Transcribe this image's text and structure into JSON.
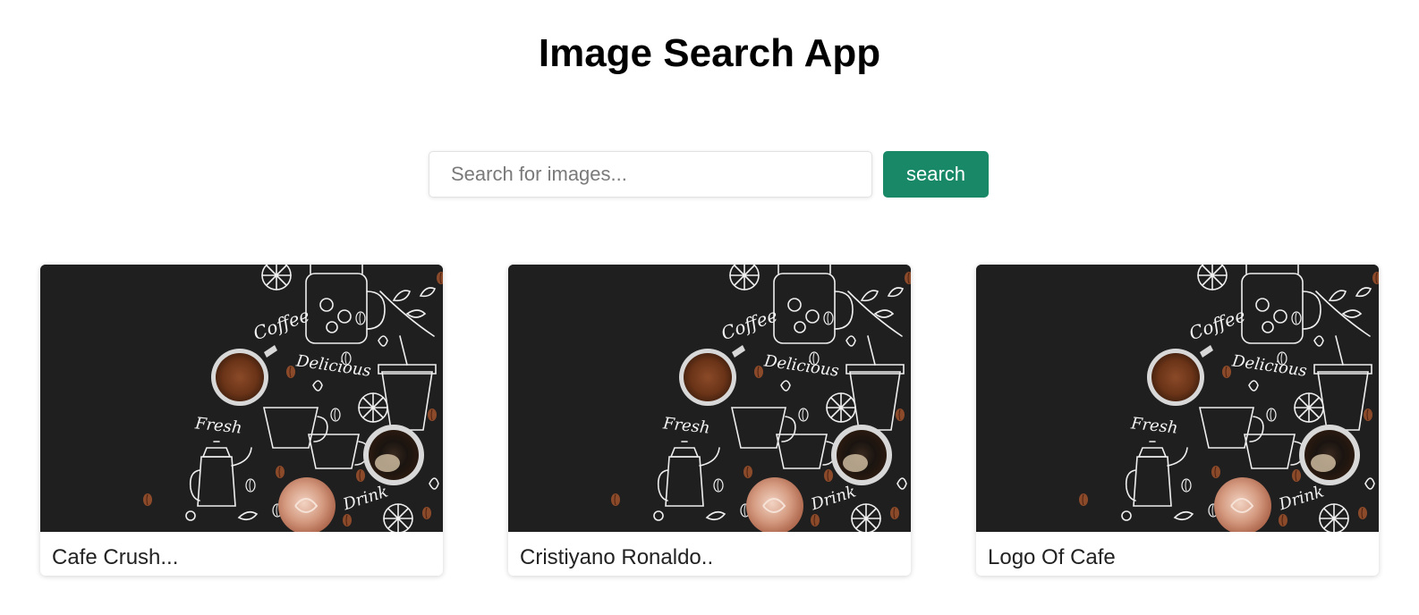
{
  "app": {
    "title": "Image Search App"
  },
  "search": {
    "placeholder": "Search for images...",
    "value": "",
    "button_label": "search",
    "button_color": "#188866"
  },
  "results": [
    {
      "caption": "Cafe Crush...",
      "image": "coffee-doodle-illustration",
      "image_words": [
        "Coffee",
        "Delicious",
        "Fresh",
        "Drink"
      ]
    },
    {
      "caption": "Cristiyano Ronaldo..",
      "image": "coffee-doodle-illustration",
      "image_words": [
        "Coffee",
        "Delicious",
        "Fresh",
        "Drink"
      ]
    },
    {
      "caption": "Logo Of Cafe",
      "image": "coffee-doodle-illustration",
      "image_words": [
        "Coffee",
        "Delicious",
        "Fresh",
        "Drink"
      ]
    }
  ],
  "colors": {
    "image_background": "#201f1f",
    "accent": "#188866"
  }
}
